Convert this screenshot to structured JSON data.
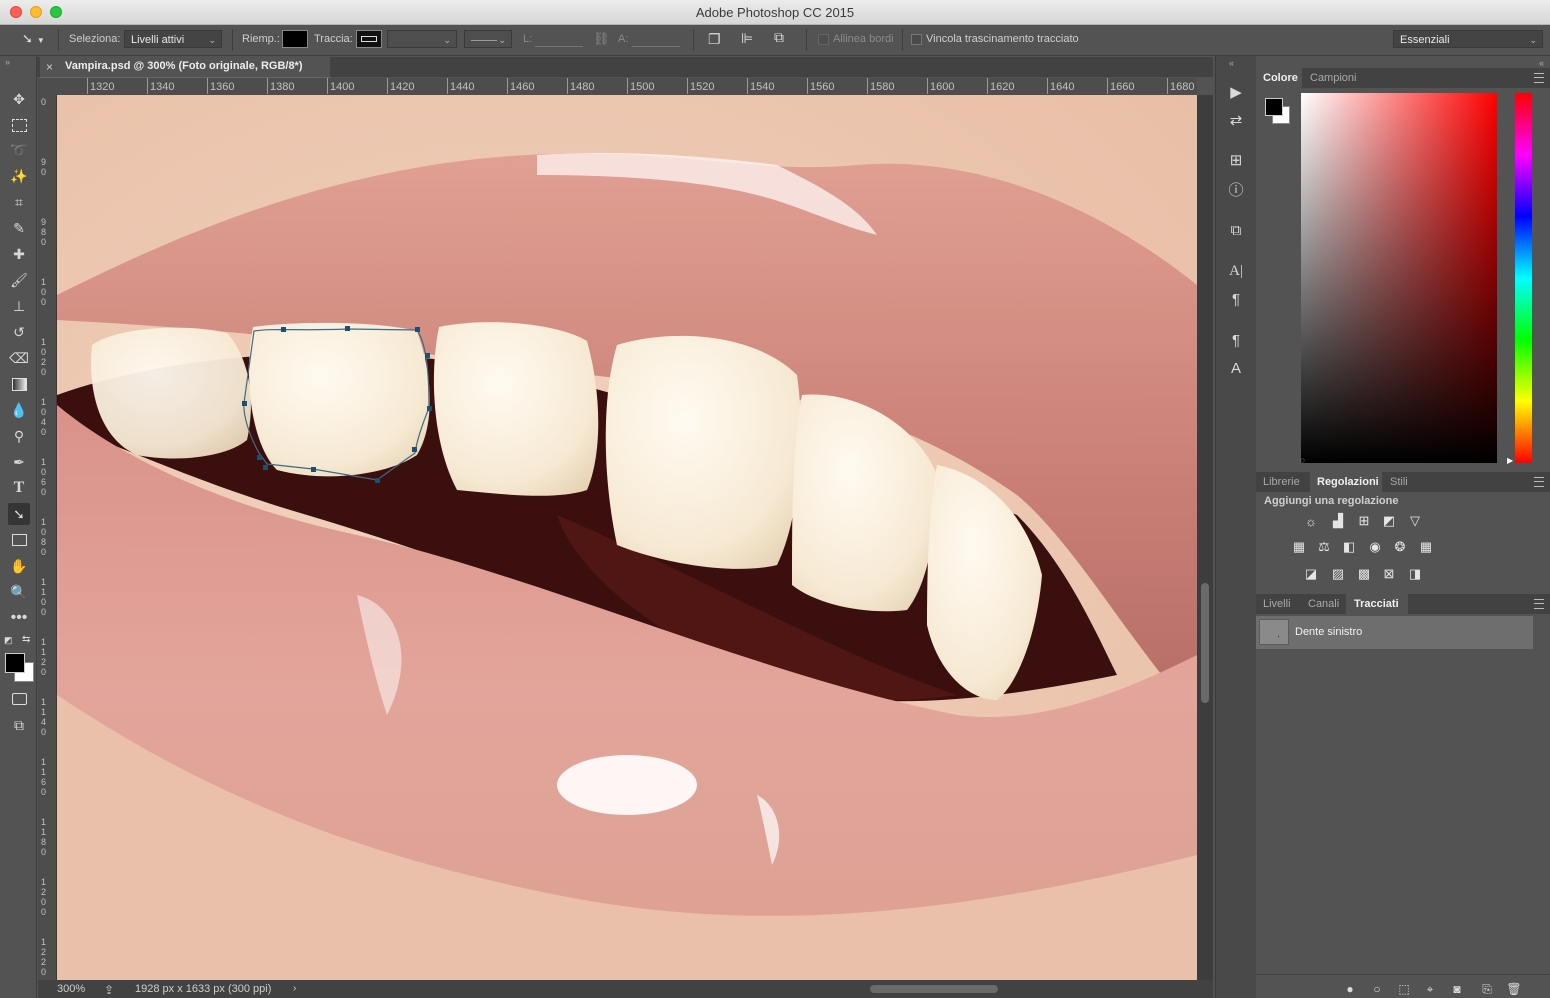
{
  "window": {
    "title": "Adobe Photoshop CC 2015"
  },
  "options": {
    "select_label": "Seleziona:",
    "select_value": "Livelli attivi",
    "fill_label": "Riemp.:",
    "stroke_label": "Traccia:",
    "width_label": "L:",
    "height_label": "A:",
    "align_edges_label": "Allinea bordi",
    "constrain_label": "Vincola trascinamento tracciato",
    "workspace": "Essenziali"
  },
  "document": {
    "tab_title": "Vampira.psd @ 300% (Foto originale, RGB/8*)",
    "close_symbol": "×",
    "zoom": "300%",
    "doc_info": "1928 px x 1633 px (300 ppi)"
  },
  "ruler": {
    "h_ticks": [
      "1320",
      "1340",
      "1360",
      "1380",
      "1400",
      "1420",
      "1440",
      "1460",
      "1480",
      "1500",
      "1520",
      "1540",
      "1560",
      "1580",
      "1600",
      "1620",
      "1640",
      "1660",
      "1680"
    ],
    "v_ticks": [
      "0",
      "9 0",
      "9 8 0",
      "1 0 0",
      "1 0 2 0",
      "1 0 4 0",
      "1 0 6 0",
      "1 0 8 0",
      "1 1 0 0",
      "1 1 2 0",
      "1 1 4 0",
      "1 1 6 0",
      "1 1 8 0",
      "1 2 0 0",
      "1 2 2 0"
    ]
  },
  "panels": {
    "color_tabs": [
      "Colore",
      "Campioni"
    ],
    "adj_tabs": [
      "Librerie",
      "Regolazioni",
      "Stili"
    ],
    "adj_title": "Aggiungi una regolazione",
    "layers_tabs": [
      "Livelli",
      "Canali",
      "Tracciati"
    ],
    "path_item": "Dente sinistro",
    "path_thumb_glyph": "."
  },
  "colors": {
    "accent": "#6a9fb5",
    "foreground": "#000000",
    "background": "#ffffff"
  }
}
